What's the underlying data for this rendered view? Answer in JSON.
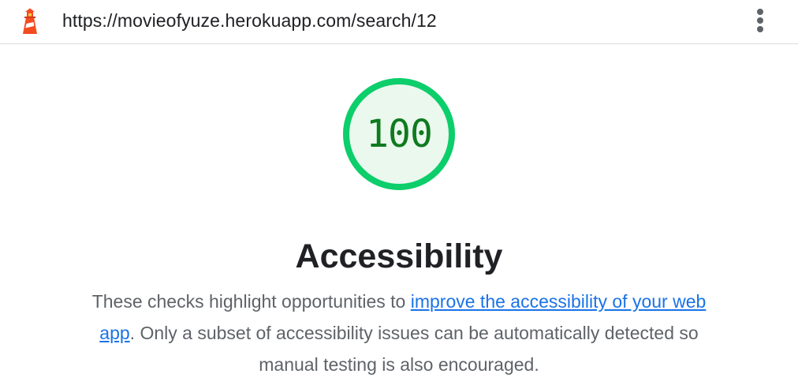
{
  "browser": {
    "url": "https://movieofyuze.herokuapp.com/search/12",
    "logo_icon": "lighthouse-icon",
    "menu_icon": "vertical-ellipsis-icon"
  },
  "report": {
    "score": "100",
    "score_fraction": 1.0,
    "category_title": "Accessibility",
    "description_prefix": "These checks highlight opportunities to ",
    "description_link": "improve the accessibility of your web app",
    "description_suffix": ". Only a subset of accessibility issues can be automatically detected so manual testing is also encouraged."
  },
  "colors": {
    "score_good": "#0cce6b",
    "score_text": "#0f7a1e",
    "link": "#1a73e8",
    "logo_red": "#f44b21",
    "logo_yellow": "#f7ca3c"
  }
}
